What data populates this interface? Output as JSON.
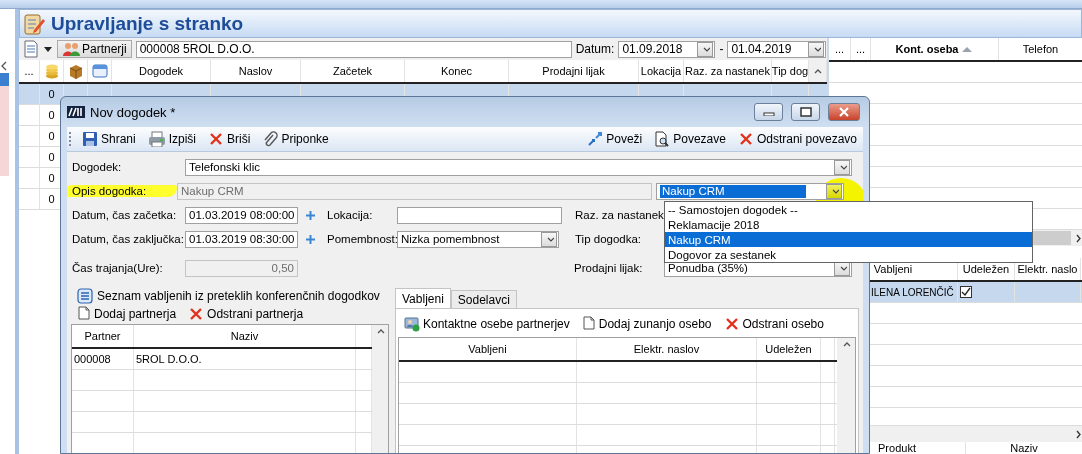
{
  "app": {
    "title": "Upravljanje s stranko",
    "toolbar": {
      "partners_button": "Partnerji",
      "partner": "000008 5ROL D.O.O.",
      "date_label": "Datum:",
      "date_from": "01.09.2018",
      "date_separator": "-",
      "date_to": "01.04.2019"
    }
  },
  "events_table": {
    "columns": [
      {
        "kind": "text",
        "label": "..."
      },
      {
        "kind": "coins"
      },
      {
        "kind": "box"
      },
      {
        "kind": "window"
      },
      {
        "kind": "text",
        "label": "Dogodek"
      },
      {
        "kind": "text",
        "label": "Naslov"
      },
      {
        "kind": "text",
        "label": "Začetek"
      },
      {
        "kind": "text",
        "label": "Konec"
      },
      {
        "kind": "text",
        "label": "Prodajni lijak"
      },
      {
        "kind": "text",
        "label": "Lokacija"
      },
      {
        "kind": "text",
        "label": "Raz. za nastanek"
      },
      {
        "kind": "text",
        "label": "Tip dog"
      }
    ],
    "rows": [
      {
        "selected": true,
        "cells": [
          null,
          "0"
        ]
      },
      {
        "selected": false,
        "cells": [
          null,
          "0"
        ]
      },
      {
        "selected": false,
        "cells": [
          null,
          "0"
        ]
      },
      {
        "selected": false,
        "cells": [
          null,
          "0"
        ]
      },
      {
        "selected": false,
        "cells": [
          null,
          "0"
        ]
      },
      {
        "selected": false,
        "cells": [
          null,
          "0"
        ]
      }
    ]
  },
  "contacts_table": {
    "columns": [
      {
        "label": "...",
        "sorted": false
      },
      {
        "label": "...",
        "sorted": false
      },
      {
        "label": "Kont. oseba",
        "sorted": true
      },
      {
        "label": "Telefon",
        "sorted": false
      }
    ]
  },
  "event_invitees": {
    "columns": [
      "Vabljeni",
      "Udeležen",
      "Elektr. naslo"
    ],
    "rows": [
      {
        "name": "ILENA LORENČIČ",
        "attended": true,
        "selected": true
      }
    ]
  },
  "products_table": {
    "columns": [
      "Produkt",
      "Naziv"
    ]
  },
  "dialog": {
    "title": "Nov dogodek *",
    "toolbar_left": [
      {
        "kind": "save",
        "label": "Shrani"
      },
      {
        "kind": "print",
        "label": "Izpiši"
      },
      {
        "kind": "delete",
        "label": "Briši"
      },
      {
        "kind": "clip",
        "label": "Priponke"
      }
    ],
    "toolbar_right": [
      {
        "kind": "link",
        "label": "Poveži"
      },
      {
        "kind": "docsearch",
        "label": "Povezave"
      },
      {
        "kind": "delete",
        "label": "Odstrani povezavo"
      }
    ],
    "form": {
      "event": {
        "label": "Dogodek:",
        "value": "Telefonski klic"
      },
      "description": {
        "label": "Opis dogodka:",
        "value": "Nakup CRM",
        "disabled": true,
        "highlighted": true
      },
      "parent_event": {
        "value": "Nakup CRM",
        "open": true,
        "highlighted": true,
        "options": [
          {
            "label": "-- Samostojen dogodek --",
            "selected": false
          },
          {
            "label": "Reklamacije 2018",
            "selected": false
          },
          {
            "label": "Nakup CRM",
            "selected": true
          },
          {
            "label": "Dogovor za sestanek",
            "selected": false
          }
        ]
      },
      "start": {
        "label": "Datum, čas začetka:",
        "value": "01.03.2019 08:00:00"
      },
      "location": {
        "label": "Lokacija:"
      },
      "reason": {
        "label": "Raz. za nastanek:"
      },
      "end": {
        "label": "Datum, čas zaključka:",
        "value": "01.03.2019 08:30:00"
      },
      "importance": {
        "label": "Pomembnost:",
        "value": "Nizka pomembnost"
      },
      "event_type": {
        "label": "Tip dogodka:"
      },
      "duration": {
        "label": "Čas trajanja(Ure):",
        "value": "0,50",
        "disabled": true
      },
      "funnel": {
        "label": "Prodajni lijak:",
        "value": "Ponudba (35%)"
      }
    },
    "partners": {
      "link": "Seznam vabljenih iz preteklih konferenčnih dogodkov",
      "toolbar": [
        {
          "kind": "page",
          "label": "Dodaj partnerja"
        },
        {
          "kind": "delete",
          "label": "Odstrani partnerja"
        }
      ],
      "columns": [
        "Partner",
        "Naziv"
      ],
      "rows": [
        {
          "cells": [
            "000008",
            "5ROL D.O.O."
          ]
        }
      ]
    },
    "invitees": {
      "tabs": [
        {
          "label": "Vabljeni",
          "selected": true
        },
        {
          "label": "Sodelavci",
          "selected": false
        }
      ],
      "toolbar": [
        {
          "kind": "contacts",
          "label": "Kontaktne osebe partnerjev"
        },
        {
          "kind": "page",
          "label": "Dodaj zunanjo osebo"
        },
        {
          "kind": "delete",
          "label": "Odstrani osebo"
        }
      ],
      "columns": [
        "Vabljeni",
        "Elektr. naslov",
        "Udeležen"
      ]
    }
  }
}
